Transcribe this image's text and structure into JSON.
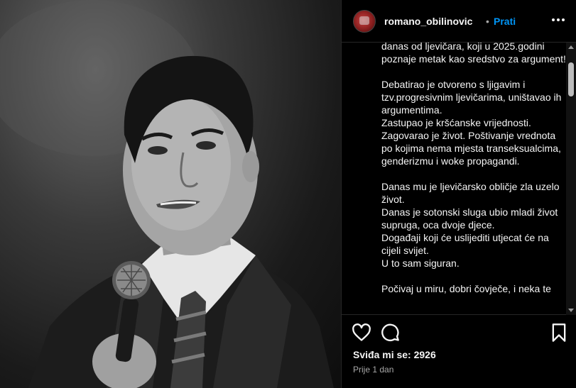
{
  "post": {
    "image_alt": "Black and white photo of a man speaking into a microphone",
    "icons": [
      "heart-icon",
      "comment-icon",
      "bookmark-icon",
      "more-options-icon"
    ]
  },
  "header": {
    "username": "romano_obilinovic",
    "separator": "•",
    "follow_label": "Prati"
  },
  "caption": {
    "text": "danas od ljevičara, koji u 2025.godini poznaje metak kao sredstvo za argument!\n\nDebatirao je otvoreno s ljigavim i tzv.progresivnim ljevičarima, uništavao ih argumentima.\nZastupao je kršćanske vrijednosti. Zagovarao je život. Poštivanje vrednota po kojima nema mjesta transeksualcima, genderizmu i woke propagandi.\n\nDanas mu je ljevičarsko obličje zla uzelo život.\nDanas je sotonski sluga ubio mladi život supruga, oca dvoje djece.\nDogađaji koji će uslijediti utjecat će na cijeli svijet.\nU to sam siguran.\n\nPočivaj u miru, dobri čovječe, i neka te"
  },
  "footer": {
    "likes_text": "Sviđa mi se: 2926",
    "time_text": "Prije 1 dan"
  }
}
